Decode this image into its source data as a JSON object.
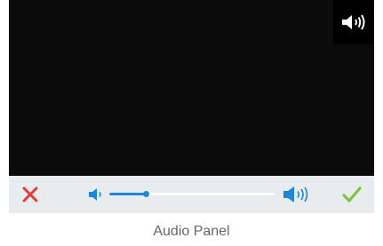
{
  "panel": {
    "speaker_icon": "speaker-volume-icon",
    "cancel_icon": "close-x-icon",
    "confirm_icon": "checkmark-icon",
    "volume_low_icon": "volume-low-icon",
    "volume_high_icon": "volume-high-icon",
    "volume_level": 0.22
  },
  "colors": {
    "video_background": "#0b0b0b",
    "control_bar": "#e9ecef",
    "cancel": "#e53935",
    "confirm": "#7cc243",
    "slider_accent": "#1e88d6"
  },
  "caption": "Audio Panel"
}
